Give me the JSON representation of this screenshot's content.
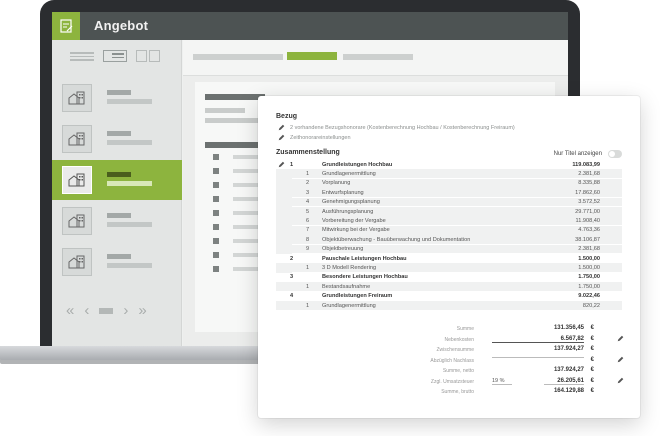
{
  "app": {
    "title": "Angebot",
    "accent_color": "#8db43e",
    "header_color": "#4d5353"
  },
  "view_toggles": [
    "list-view-icon",
    "detail-view-icon",
    "grid-view-icon"
  ],
  "pager": {
    "first": "«",
    "prev": "‹",
    "next": "›",
    "last": "»"
  },
  "card": {
    "bezug": {
      "title": "Bezug",
      "items": [
        "2 vorhandene Bezugshonorare (Kostenberechnung Hochbau / Kostenberechnung Freiraum)",
        "Zeithonorareinstellungen"
      ]
    },
    "zusammenstellung": {
      "title": "Zusammenstellung",
      "toggle_label": "Nur Titel anzeigen",
      "rows": [
        {
          "type": "group",
          "num": "1",
          "label": "Grundleistungen Hochbau",
          "amount": "119.083,99",
          "editable": true
        },
        {
          "type": "sub",
          "num": "1",
          "label": "Grundlagenermittlung",
          "amount": "2.381,68"
        },
        {
          "type": "sub",
          "num": "2",
          "label": "Vorplanung",
          "amount": "8.335,88"
        },
        {
          "type": "sub",
          "num": "3",
          "label": "Entwurfsplanung",
          "amount": "17.862,60"
        },
        {
          "type": "sub",
          "num": "4",
          "label": "Genehmigungsplanung",
          "amount": "3.572,52"
        },
        {
          "type": "sub",
          "num": "5",
          "label": "Ausführungsplanung",
          "amount": "29.771,00"
        },
        {
          "type": "sub",
          "num": "6",
          "label": "Vorbereitung der Vergabe",
          "amount": "11.908,40"
        },
        {
          "type": "sub",
          "num": "7",
          "label": "Mitwirkung bei der Vergabe",
          "amount": "4.763,36"
        },
        {
          "type": "sub",
          "num": "8",
          "label": "Objektüberwachung - Bauüberwachung und Dokumentation",
          "amount": "38.106,87"
        },
        {
          "type": "sub",
          "num": "9",
          "label": "Objektbetreuung",
          "amount": "2.381,68"
        },
        {
          "type": "group",
          "num": "2",
          "label": "Pauschale Leistungen Hochbau",
          "amount": "1.500,00"
        },
        {
          "type": "sub",
          "num": "1",
          "label": "3 D Modell Rendering",
          "amount": "1.500,00"
        },
        {
          "type": "group",
          "num": "3",
          "label": "Besondere Leistungen Hochbau",
          "amount": "1.750,00"
        },
        {
          "type": "sub",
          "num": "1",
          "label": "Bestandsaufnahme",
          "amount": "1.750,00"
        },
        {
          "type": "group",
          "num": "4",
          "label": "Grundleistungen Freiraum",
          "amount": "9.022,46"
        },
        {
          "type": "sub",
          "num": "1",
          "label": "Grundlagenermittlung",
          "amount": "820,22"
        }
      ]
    },
    "summary": {
      "currency": "€",
      "rows": [
        {
          "label": "Summe",
          "value": "131.356,45",
          "style": "plain",
          "editable": false
        },
        {
          "label": "Nebenkosten",
          "value": "6.567,82",
          "style": "under",
          "editable": true
        },
        {
          "label": "Zwischensumme",
          "value": "137.924,27",
          "style": "plain",
          "editable": false
        },
        {
          "label": "Abzüglich Nachlass",
          "value": "",
          "style": "line",
          "editable": true
        },
        {
          "label": "Summe, netto",
          "value": "137.924,27",
          "style": "plain",
          "editable": false
        },
        {
          "label": "Zzgl. Umsatzsteuer",
          "value": "26.205,61",
          "percent": "19 %",
          "style": "pct",
          "editable": true
        },
        {
          "label": "Summe, brutto",
          "value": "164.129,88",
          "style": "plain",
          "editable": false
        }
      ]
    }
  }
}
